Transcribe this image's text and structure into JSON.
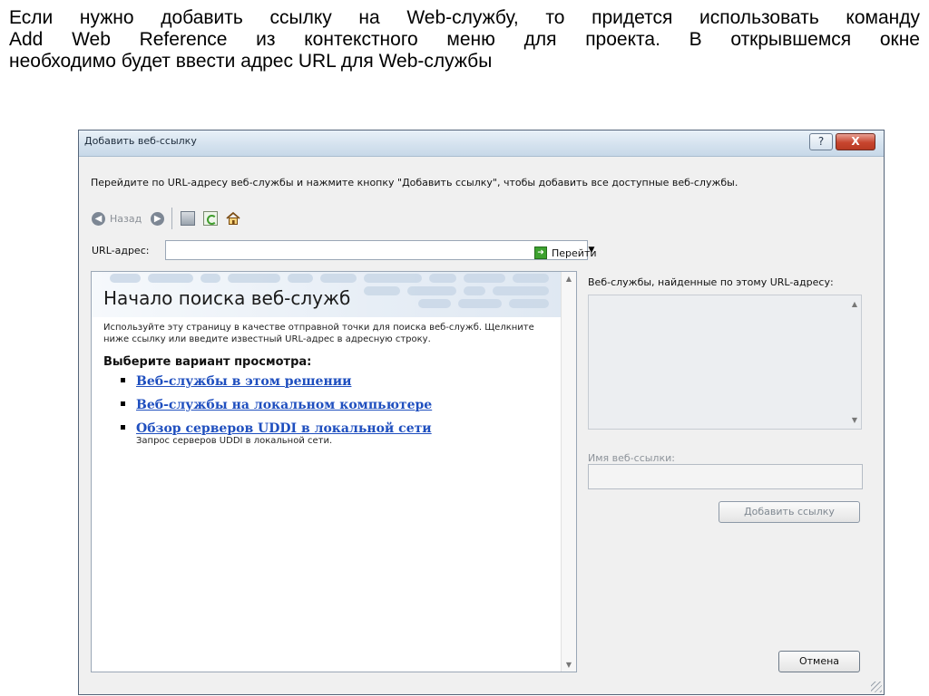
{
  "slide": {
    "line1": "Если нужно добавить ссылку на Web-службу, то придется использовать команду",
    "line2": "Add Web Reference из контекстного меню для проекта. В открывшемся окне",
    "line3": "необходимо будет ввести адрес URL для Web-службы"
  },
  "dialog": {
    "title": "Добавить веб-ссылку",
    "help_label": "?",
    "close_label": "X",
    "intro": "Перейдите по URL-адресу веб-службы и нажмите кнопку \"Добавить ссылку\", чтобы добавить все доступные веб-службы.",
    "nav": {
      "back_label": "Назад"
    },
    "url_label": "URL-адрес:",
    "url_value": "",
    "go_label": "Перейти",
    "browser": {
      "heading": "Начало поиска веб-служб",
      "description": "Используйте эту страницу в качестве отправной точки для поиска веб-служб. Щелкните ниже ссылку или введите известный URL-адрес в адресную строку.",
      "choose_label": "Выберите вариант просмотра:",
      "links": [
        {
          "label": "Веб-службы в этом решении",
          "sub": ""
        },
        {
          "label": "Веб-службы на локальном компьютере",
          "sub": ""
        },
        {
          "label": "Обзор серверов UDDI в локальной сети",
          "sub": "Запрос серверов UDDI в локальной сети."
        }
      ]
    },
    "found_label": "Веб-службы, найденные по этому URL-адресу:",
    "ref_name_label": "Имя веб-ссылки:",
    "ref_name_value": "",
    "add_button": "Добавить ссылку",
    "cancel_button": "Отмена"
  }
}
